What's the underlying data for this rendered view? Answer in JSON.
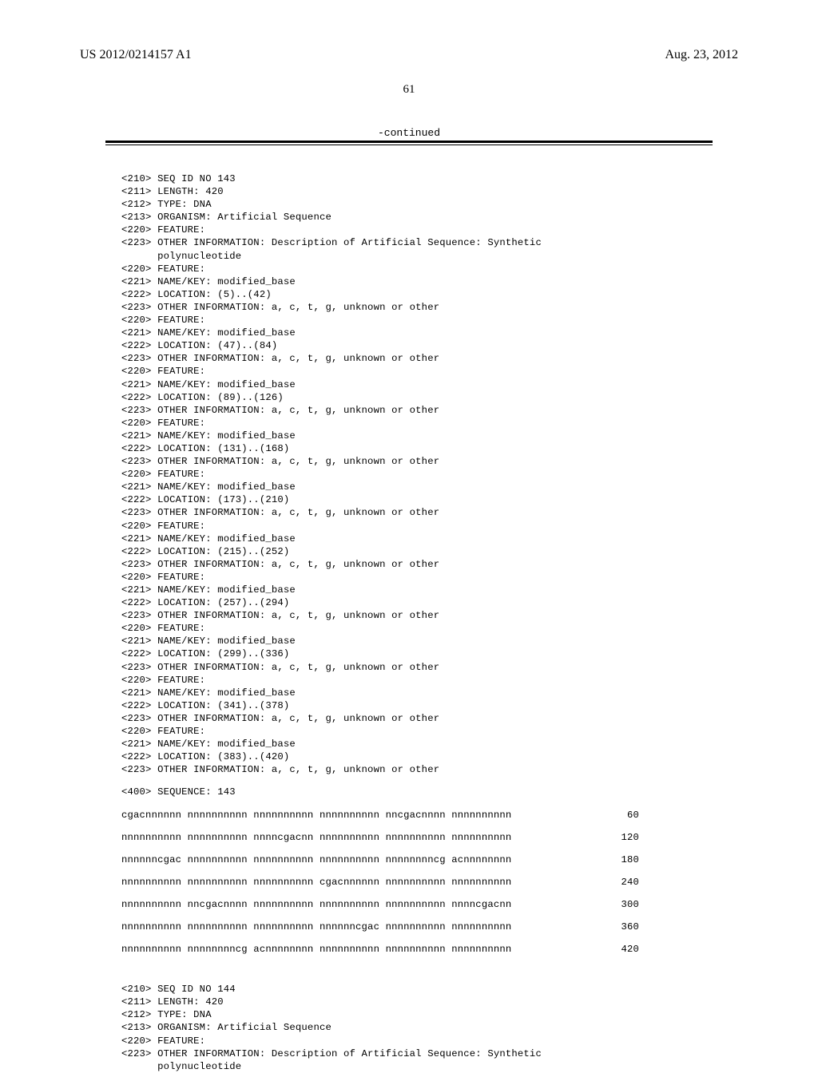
{
  "header": {
    "pub_number": "US 2012/0214157 A1",
    "pub_date": "Aug. 23, 2012"
  },
  "page_number": "61",
  "continued_label": "-continued",
  "seq143": {
    "header": [
      "<210> SEQ ID NO 143",
      "<211> LENGTH: 420",
      "<212> TYPE: DNA",
      "<213> ORGANISM: Artificial Sequence",
      "<220> FEATURE:",
      "<223> OTHER INFORMATION: Description of Artificial Sequence: Synthetic",
      "      polynucleotide",
      "<220> FEATURE:",
      "<221> NAME/KEY: modified_base",
      "<222> LOCATION: (5)..(42)",
      "<223> OTHER INFORMATION: a, c, t, g, unknown or other",
      "<220> FEATURE:",
      "<221> NAME/KEY: modified_base",
      "<222> LOCATION: (47)..(84)",
      "<223> OTHER INFORMATION: a, c, t, g, unknown or other",
      "<220> FEATURE:",
      "<221> NAME/KEY: modified_base",
      "<222> LOCATION: (89)..(126)",
      "<223> OTHER INFORMATION: a, c, t, g, unknown or other",
      "<220> FEATURE:",
      "<221> NAME/KEY: modified_base",
      "<222> LOCATION: (131)..(168)",
      "<223> OTHER INFORMATION: a, c, t, g, unknown or other",
      "<220> FEATURE:",
      "<221> NAME/KEY: modified_base",
      "<222> LOCATION: (173)..(210)",
      "<223> OTHER INFORMATION: a, c, t, g, unknown or other",
      "<220> FEATURE:",
      "<221> NAME/KEY: modified_base",
      "<222> LOCATION: (215)..(252)",
      "<223> OTHER INFORMATION: a, c, t, g, unknown or other",
      "<220> FEATURE:",
      "<221> NAME/KEY: modified_base",
      "<222> LOCATION: (257)..(294)",
      "<223> OTHER INFORMATION: a, c, t, g, unknown or other",
      "<220> FEATURE:",
      "<221> NAME/KEY: modified_base",
      "<222> LOCATION: (299)..(336)",
      "<223> OTHER INFORMATION: a, c, t, g, unknown or other",
      "<220> FEATURE:",
      "<221> NAME/KEY: modified_base",
      "<222> LOCATION: (341)..(378)",
      "<223> OTHER INFORMATION: a, c, t, g, unknown or other",
      "<220> FEATURE:",
      "<221> NAME/KEY: modified_base",
      "<222> LOCATION: (383)..(420)",
      "<223> OTHER INFORMATION: a, c, t, g, unknown or other"
    ],
    "seq_label": "<400> SEQUENCE: 143",
    "rows": [
      {
        "text": "cgacnnnnnn nnnnnnnnnn nnnnnnnnnn nnnnnnnnnn nncgacnnnn nnnnnnnnnn",
        "pos": "60"
      },
      {
        "text": "nnnnnnnnnn nnnnnnnnnn nnnncgacnn nnnnnnnnnn nnnnnnnnnn nnnnnnnnnn",
        "pos": "120"
      },
      {
        "text": "nnnnnncgac nnnnnnnnnn nnnnnnnnnn nnnnnnnnnn nnnnnnnncg acnnnnnnnn",
        "pos": "180"
      },
      {
        "text": "nnnnnnnnnn nnnnnnnnnn nnnnnnnnnn cgacnnnnnn nnnnnnnnnn nnnnnnnnnn",
        "pos": "240"
      },
      {
        "text": "nnnnnnnnnn nncgacnnnn nnnnnnnnnn nnnnnnnnnn nnnnnnnnnn nnnncgacnn",
        "pos": "300"
      },
      {
        "text": "nnnnnnnnnn nnnnnnnnnn nnnnnnnnnn nnnnnncgac nnnnnnnnnn nnnnnnnnnn",
        "pos": "360"
      },
      {
        "text": "nnnnnnnnnn nnnnnnnncg acnnnnnnnn nnnnnnnnnn nnnnnnnnnn nnnnnnnnnn",
        "pos": "420"
      }
    ]
  },
  "seq144": {
    "header": [
      "<210> SEQ ID NO 144",
      "<211> LENGTH: 420",
      "<212> TYPE: DNA",
      "<213> ORGANISM: Artificial Sequence",
      "<220> FEATURE:",
      "<223> OTHER INFORMATION: Description of Artificial Sequence: Synthetic",
      "      polynucleotide"
    ]
  }
}
